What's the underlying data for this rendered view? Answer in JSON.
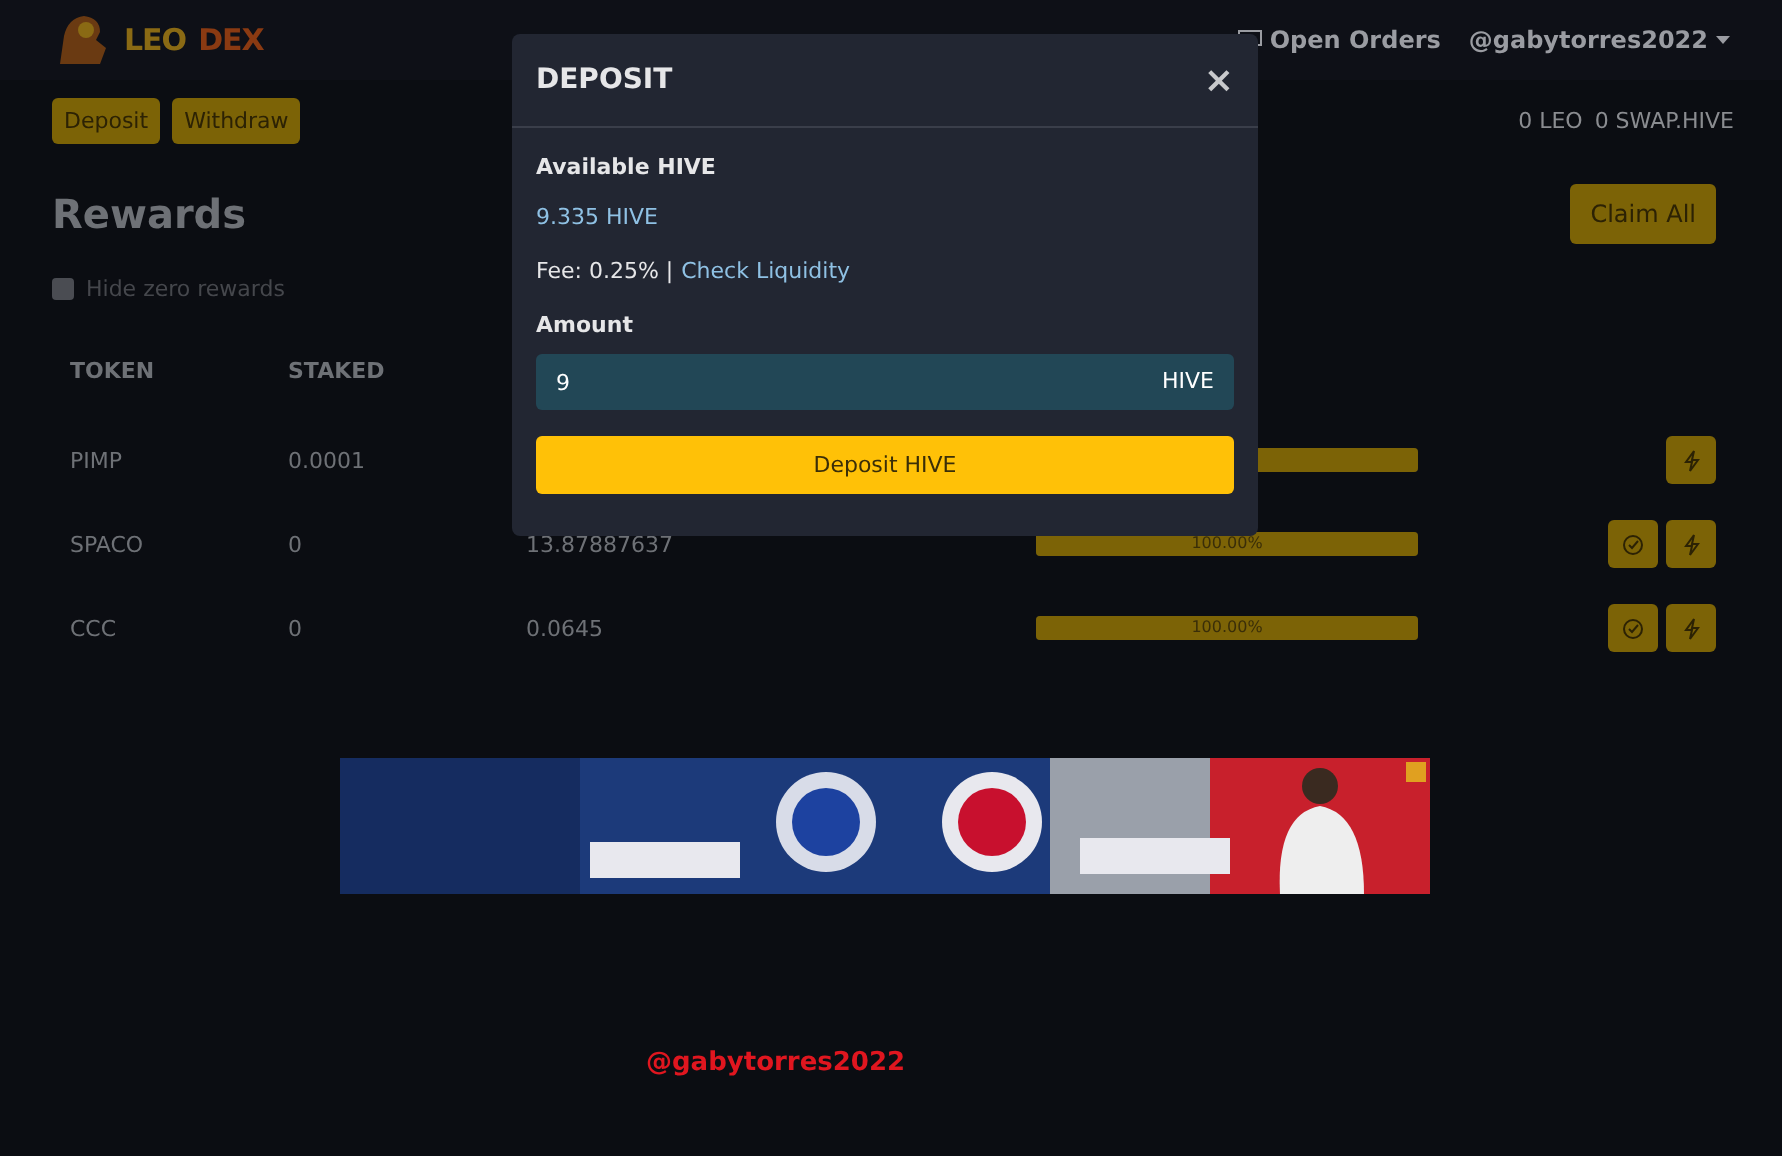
{
  "navbar": {
    "logo": {
      "part_1": "LEO",
      "part_2": "DEX"
    },
    "open_orders": "Open Orders",
    "user": "@gabytorres2022"
  },
  "subbar": {
    "buttons": [
      "Deposit",
      "Withdraw"
    ],
    "balances": [
      "0 LEO",
      "0 SWAP.HIVE"
    ]
  },
  "rewards": {
    "title": "Rewards",
    "claim_all": "Claim All",
    "hide_zero": {
      "label": "Hide zero rewards",
      "checked": false
    },
    "columns": [
      "TOKEN",
      "STAKED"
    ],
    "rows": [
      {
        "token": "PIMP",
        "staked": "0.0001",
        "level": 1,
        "claim_button": false
      },
      {
        "token": "SPACO",
        "staked": "0",
        "pending": "13.87887637",
        "level": 1,
        "percent": "100.00%",
        "claim_button": true
      },
      {
        "token": "CCC",
        "staked": "0",
        "pending": "0.0645",
        "level": 1,
        "percent": "100.00%",
        "claim_button": true
      }
    ]
  },
  "signature": "@gabytorres2022",
  "modal": {
    "title": "DEPOSIT",
    "close": "×",
    "available_label": "Available HIVE",
    "available_value": "9.335 HIVE",
    "fee": "Fee: 0.25% |",
    "liquidity_link": "Check Liquidity",
    "amount_label": "Amount",
    "amount_value": "9",
    "amount_unit": "HIVE",
    "submit": "Deposit HIVE"
  }
}
